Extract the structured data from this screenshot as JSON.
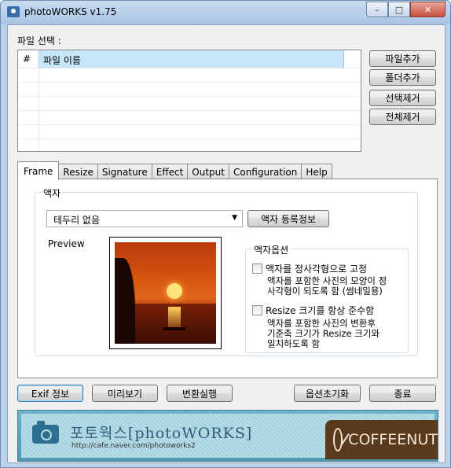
{
  "window": {
    "title": "photoWORKS v1.75",
    "minimize": "–",
    "maximize": "□",
    "close": "✕"
  },
  "file_select": {
    "label": "파일 선택 :",
    "columns": [
      "#",
      "파일 이름"
    ],
    "buttons": {
      "add_file": "파일추가",
      "add_folder": "폴더추가",
      "remove_selected": "선택제거",
      "remove_all": "전체제거"
    }
  },
  "tabs": [
    "Frame",
    "Resize",
    "Signature",
    "Effect",
    "Output",
    "Configuration",
    "Help"
  ],
  "frame": {
    "group_label": "액자",
    "combo_value": "테두리 없음",
    "register_button": "액자 등록정보",
    "preview_label": "Preview",
    "options": {
      "group_label": "액자옵션",
      "square_label": "액자를 정사각형으로 고정",
      "square_desc_1": "액자를 포함한 사진의 모양이 정",
      "square_desc_2": "사각형이 되도록 함 (썸네일용)",
      "resize_label": "Resize 크기를 항상 준수함",
      "resize_desc_1": "액자를 포함한 사진의 변환후",
      "resize_desc_2": "기준축 크기가 Resize 크기와",
      "resize_desc_3": "일치하도록 함"
    }
  },
  "bottom_buttons": {
    "exif": "Exif 정보",
    "preview": "미리보기",
    "convert": "변환실행",
    "reset": "옵션초기화",
    "exit": "종료"
  },
  "banner": {
    "title": "포토웍스[photoWORKS]",
    "url": "http://cafe.naver.com/photoworks2",
    "brand": "COFFEENUT"
  }
}
